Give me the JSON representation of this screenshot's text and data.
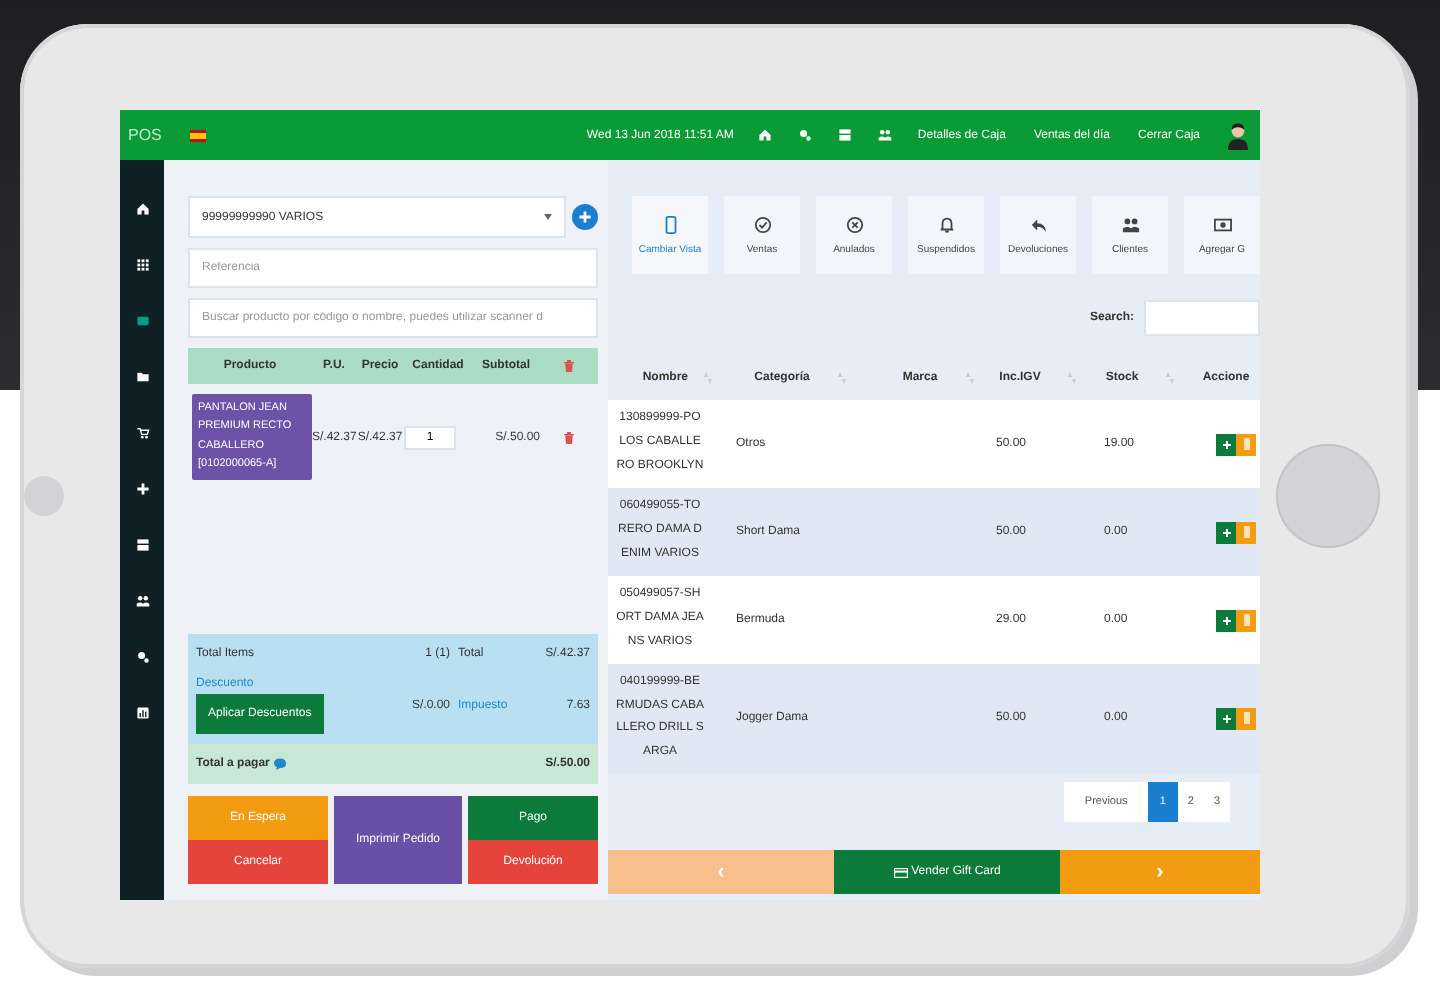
{
  "topbar": {
    "title": "POS",
    "datetime": "Wed 13 Jun 2018 11:51 AM",
    "links": [
      "Detalles de Caja",
      "Ventas del día",
      "Cerrar Caja"
    ]
  },
  "sidebar": {
    "items": [
      {
        "kind": "home",
        "selected": false
      },
      {
        "kind": "grid",
        "selected": false
      },
      {
        "kind": "card",
        "selected": true
      },
      {
        "kind": "folder",
        "selected": false
      },
      {
        "kind": "cart",
        "selected": false
      },
      {
        "kind": "plus",
        "selected": false
      },
      {
        "kind": "register",
        "selected": false
      },
      {
        "kind": "users",
        "selected": false
      },
      {
        "kind": "settings",
        "selected": false
      },
      {
        "kind": "report",
        "selected": false
      }
    ]
  },
  "order": {
    "customer": "99999999990 VARIOS",
    "reference": {
      "placeholder": "Referencia"
    },
    "search": {
      "placeholder": "Buscar producto por código o nombre, puedes utilizar scanner d"
    },
    "columns": [
      "Producto",
      "P.U.",
      "Precio",
      "Cantidad",
      "Subtotal"
    ],
    "rows": [
      {
        "product": "PANTALON JEAN PREMIUM RECTO CABALLERO [0102000065-A]",
        "unit_price": "S/.42.37",
        "price": "S/.42.37",
        "quantity": "1",
        "subtotal": "S/.50.00"
      }
    ],
    "totals": {
      "items_label": "Total Items",
      "items_value": "1 (1)",
      "total_label": "Total",
      "total_value": "S/.42.37",
      "discount_label": "Descuento",
      "discount_button": "Aplicar Descuentos",
      "discount_value": "S/.0.00",
      "tax_label": "Impuesto",
      "tax_value": "7.63",
      "due_label": "Total a pagar",
      "due_value": "S/.50.00"
    },
    "actions": [
      {
        "label": "En Espera",
        "kind": "hold"
      },
      {
        "label": "Imprimir Pedido",
        "kind": "print"
      },
      {
        "label": "Pago",
        "kind": "pay"
      },
      {
        "label": "Cancelar",
        "kind": "cancel"
      },
      {
        "label": "Devolución",
        "kind": "refund"
      }
    ]
  },
  "products": {
    "toolbar": [
      {
        "label": "Cambiar Vista",
        "kind": "tablet",
        "selected": true
      },
      {
        "label": "Ventas",
        "kind": "check",
        "selected": false
      },
      {
        "label": "Anulados",
        "kind": "cancel",
        "selected": false
      },
      {
        "label": "Suspendidos",
        "kind": "bell",
        "selected": false
      },
      {
        "label": "Devoluciones",
        "kind": "reply",
        "selected": false
      },
      {
        "label": "Clientes",
        "kind": "users",
        "selected": false
      },
      {
        "label": "Agregar G",
        "kind": "money",
        "selected": false
      }
    ],
    "search_label": "Search:",
    "columns": [
      "Nombre",
      "Categoría",
      "Marca",
      "Inc.IGV",
      "Stock",
      "Accione"
    ],
    "rows": [
      {
        "name": "130899999-POLOS CABALLERO BROOKLYN",
        "category": "Otros",
        "price": "50.00",
        "stock": "19.00"
      },
      {
        "name": "060499055-TORERO DAMA DENIM VARIOS",
        "category": "Short Dama",
        "price": "50.00",
        "stock": "0.00"
      },
      {
        "name": "050499057-SHORT DAMA JEANS VARIOS",
        "category": "Bermuda",
        "price": "29.00",
        "stock": "0.00"
      },
      {
        "name": "040199999-BERMUDAS CABALLERO DRILL SARGA",
        "category": "Jogger Dama",
        "price": "50.00",
        "stock": "0.00"
      }
    ],
    "pagination": {
      "previous": "Previous",
      "pages": [
        {
          "label": "1",
          "selected": true
        },
        {
          "label": "2",
          "selected": false
        },
        {
          "label": "3",
          "selected": false
        }
      ]
    },
    "footer": {
      "previous": "‹",
      "gift_card": "Vender Gift Card",
      "next": "›"
    }
  }
}
